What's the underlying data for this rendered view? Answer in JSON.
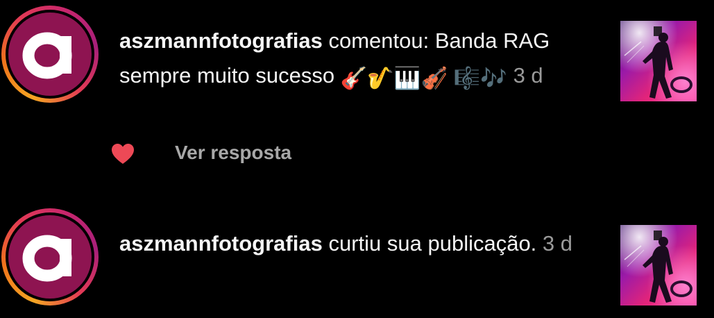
{
  "notifications": [
    {
      "username": "aszmannfotografias",
      "message": " comentou: Banda RAG sempre muito sucesso ",
      "emojis": "🎸🎷🎹🎻 🎼🎶",
      "time": "3 d",
      "liked": true,
      "reply_label": "Ver resposta",
      "avatar_letter": "a",
      "avatar_icon": "brand-a-logo-icon",
      "thumbnail_icon": "concert-photo-thumbnail"
    },
    {
      "username": "aszmannfotografias",
      "message": " curtiu sua publicação. ",
      "time": "3 d",
      "avatar_letter": "a",
      "avatar_icon": "brand-a-logo-icon",
      "thumbnail_icon": "concert-photo-thumbnail"
    }
  ],
  "colors": {
    "background": "#000000",
    "text": "#f5f5f5",
    "muted": "#9a9a9a",
    "heart": "#ed4956",
    "avatar_fill": "#8e1451"
  }
}
